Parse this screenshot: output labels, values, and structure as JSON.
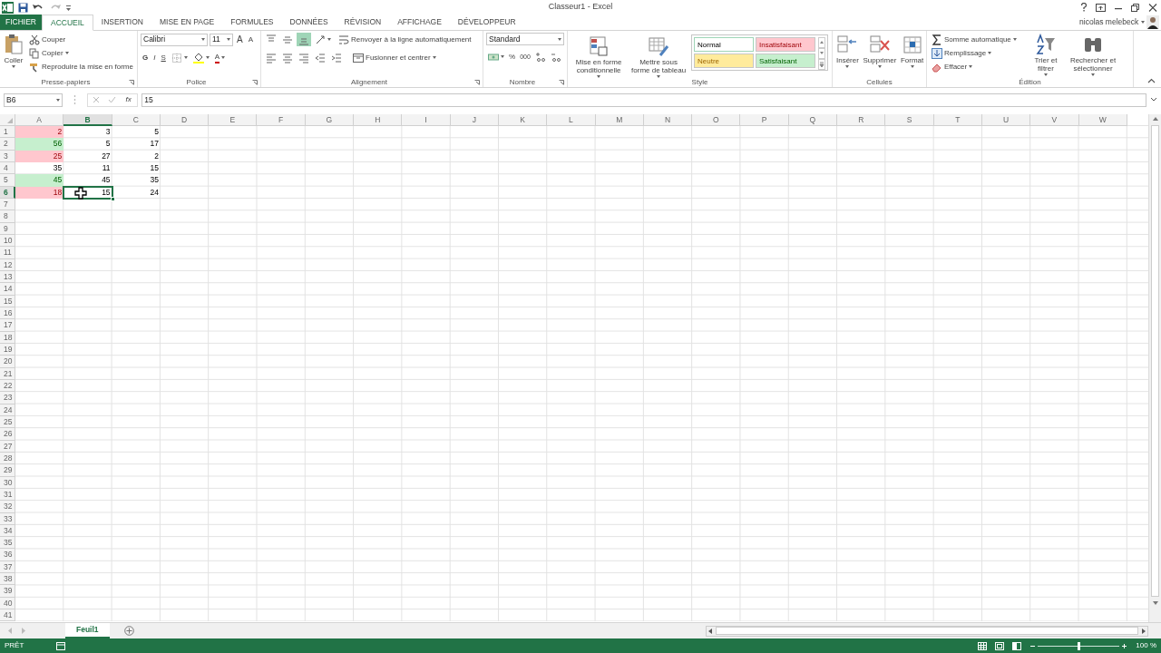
{
  "window": {
    "title": "Classeur1 - Excel",
    "user": "nicolas melebeck"
  },
  "tabs": [
    {
      "label": "FICHIER",
      "kind": "file",
      "selected": false
    },
    {
      "label": "ACCUEIL",
      "kind": "tab",
      "selected": true
    },
    {
      "label": "INSERTION",
      "kind": "tab",
      "selected": false
    },
    {
      "label": "MISE EN PAGE",
      "kind": "tab",
      "selected": false
    },
    {
      "label": "FORMULES",
      "kind": "tab",
      "selected": false
    },
    {
      "label": "DONNÉES",
      "kind": "tab",
      "selected": false
    },
    {
      "label": "RÉVISION",
      "kind": "tab",
      "selected": false
    },
    {
      "label": "AFFICHAGE",
      "kind": "tab",
      "selected": false
    },
    {
      "label": "DÉVELOPPEUR",
      "kind": "tab",
      "selected": false
    }
  ],
  "ribbon": {
    "clipboard": {
      "paste": "Coller",
      "cut": "Couper",
      "copy": "Copier",
      "format_painter": "Reproduire la mise en forme",
      "label": "Presse-papiers"
    },
    "font": {
      "name": "Calibri",
      "size": "11",
      "grow": "A",
      "shrink": "A",
      "bold": "G",
      "italic": "I",
      "underline": "S",
      "color_button": "A",
      "label": "Police"
    },
    "alignment": {
      "vertical": [
        {
          "selected": false
        },
        {
          "selected": false
        },
        {
          "selected": true
        }
      ],
      "wrap": "Renvoyer à la ligne automatiquement",
      "merge": "Fusionner et centrer",
      "label": "Alignement"
    },
    "number": {
      "format": "Standard",
      "percent": "%",
      "thousands": "000",
      "label": "Nombre"
    },
    "styles": {
      "conditional": "Mise en forme conditionnelle",
      "table": "Mettre sous forme de tableau",
      "gallery": [
        {
          "label": "Normal",
          "kind": "normal"
        },
        {
          "label": "Insatisfaisant",
          "kind": "bad"
        },
        {
          "label": "Neutre",
          "kind": "neutral"
        },
        {
          "label": "Satisfaisant",
          "kind": "good"
        }
      ],
      "label": "Style"
    },
    "cells": {
      "insert": "Insérer",
      "delete": "Supprimer",
      "format": "Format",
      "label": "Cellules"
    },
    "editing": {
      "autosum": "Somme automatique",
      "fill": "Remplissage",
      "clear": "Effacer",
      "sort": "Trier et filtrer",
      "find": "Rechercher et sélectionner",
      "label": "Édition"
    }
  },
  "formula_bar": {
    "name_box": "B6",
    "function_label": "fx",
    "value": "15"
  },
  "grid": {
    "columns": [
      {
        "label": "A",
        "selected": false
      },
      {
        "label": "B",
        "selected": true
      },
      {
        "label": "C",
        "selected": false
      },
      {
        "label": "D",
        "selected": false
      },
      {
        "label": "E",
        "selected": false
      },
      {
        "label": "F",
        "selected": false
      },
      {
        "label": "G",
        "selected": false
      },
      {
        "label": "H",
        "selected": false
      },
      {
        "label": "I",
        "selected": false
      },
      {
        "label": "J",
        "selected": false
      },
      {
        "label": "K",
        "selected": false
      },
      {
        "label": "L",
        "selected": false
      },
      {
        "label": "M",
        "selected": false
      },
      {
        "label": "N",
        "selected": false
      },
      {
        "label": "O",
        "selected": false
      },
      {
        "label": "P",
        "selected": false
      },
      {
        "label": "Q",
        "selected": false
      },
      {
        "label": "R",
        "selected": false
      },
      {
        "label": "S",
        "selected": false
      },
      {
        "label": "T",
        "selected": false
      },
      {
        "label": "U",
        "selected": false
      },
      {
        "label": "V",
        "selected": false
      },
      {
        "label": "W",
        "selected": false
      }
    ],
    "rows": [
      {
        "label": "1",
        "selected": false,
        "cells": [
          {
            "value": "2",
            "kind": "bad",
            "selected": false
          },
          {
            "value": "3",
            "kind": "plain",
            "selected": false
          },
          {
            "value": "5",
            "kind": "plain",
            "selected": false
          }
        ]
      },
      {
        "label": "2",
        "selected": false,
        "cells": [
          {
            "value": "56",
            "kind": "good",
            "selected": false
          },
          {
            "value": "5",
            "kind": "plain",
            "selected": false
          },
          {
            "value": "17",
            "kind": "plain",
            "selected": false
          }
        ]
      },
      {
        "label": "3",
        "selected": false,
        "cells": [
          {
            "value": "25",
            "kind": "bad",
            "selected": false
          },
          {
            "value": "27",
            "kind": "plain",
            "selected": false
          },
          {
            "value": "2",
            "kind": "plain",
            "selected": false
          }
        ]
      },
      {
        "label": "4",
        "selected": false,
        "cells": [
          {
            "value": "35",
            "kind": "plain",
            "selected": false
          },
          {
            "value": "11",
            "kind": "plain",
            "selected": false
          },
          {
            "value": "15",
            "kind": "plain",
            "selected": false
          }
        ]
      },
      {
        "label": "5",
        "selected": false,
        "cells": [
          {
            "value": "45",
            "kind": "good",
            "selected": false
          },
          {
            "value": "45",
            "kind": "plain",
            "selected": false
          },
          {
            "value": "35",
            "kind": "plain",
            "selected": false
          }
        ]
      },
      {
        "label": "6",
        "selected": true,
        "cells": [
          {
            "value": "18",
            "kind": "bad",
            "selected": false
          },
          {
            "value": "15",
            "kind": "plain",
            "selected": true
          },
          {
            "value": "24",
            "kind": "plain",
            "selected": false
          }
        ]
      },
      {
        "label": "7",
        "selected": false
      },
      {
        "label": "8",
        "selected": false
      },
      {
        "label": "9",
        "selected": false
      },
      {
        "label": "10",
        "selected": false
      },
      {
        "label": "11",
        "selected": false
      },
      {
        "label": "12",
        "selected": false
      },
      {
        "label": "13",
        "selected": false
      },
      {
        "label": "14",
        "selected": false
      },
      {
        "label": "15",
        "selected": false
      },
      {
        "label": "16",
        "selected": false
      },
      {
        "label": "17",
        "selected": false
      },
      {
        "label": "18",
        "selected": false
      },
      {
        "label": "19",
        "selected": false
      },
      {
        "label": "20",
        "selected": false
      },
      {
        "label": "21",
        "selected": false
      },
      {
        "label": "22",
        "selected": false
      },
      {
        "label": "23",
        "selected": false
      },
      {
        "label": "24",
        "selected": false
      },
      {
        "label": "25",
        "selected": false
      },
      {
        "label": "26",
        "selected": false
      },
      {
        "label": "27",
        "selected": false
      },
      {
        "label": "28",
        "selected": false
      },
      {
        "label": "29",
        "selected": false
      },
      {
        "label": "30",
        "selected": false
      },
      {
        "label": "31",
        "selected": false
      },
      {
        "label": "32",
        "selected": false
      },
      {
        "label": "33",
        "selected": false
      },
      {
        "label": "34",
        "selected": false
      },
      {
        "label": "35",
        "selected": false
      },
      {
        "label": "36",
        "selected": false
      },
      {
        "label": "37",
        "selected": false
      },
      {
        "label": "38",
        "selected": false
      },
      {
        "label": "39",
        "selected": false
      },
      {
        "label": "40",
        "selected": false
      },
      {
        "label": "41",
        "selected": false
      }
    ]
  },
  "sheets": [
    {
      "label": "Feuil1",
      "selected": true
    }
  ],
  "status_bar": {
    "status": "PRÊT",
    "zoom": "100 %",
    "level": 0.5
  }
}
